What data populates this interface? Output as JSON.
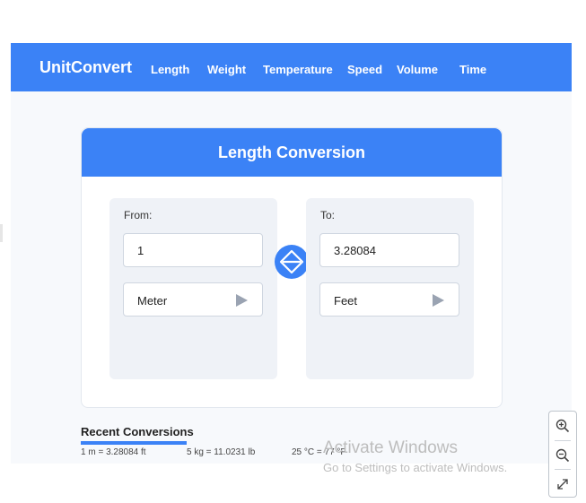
{
  "navbar": {
    "brand": "UnitConvert",
    "links": [
      "Length",
      "Weight",
      "Temperature",
      "Speed",
      "Volume",
      "Time"
    ],
    "bg_color": "#3b82f6"
  },
  "converter": {
    "title": "Length Conversion",
    "from": {
      "label": "From:",
      "value": "1",
      "unit": "Meter"
    },
    "to": {
      "label": "To:",
      "value": "3.28084",
      "unit": "Feet"
    },
    "swap_icon": "swap-icon",
    "dropdown_icon": "triangle-right-icon"
  },
  "recent": {
    "title": "Recent Conversions",
    "items": [
      "1 m = 3.28084 ft",
      "5 kg = 11.0231 lb",
      "25 °C = 77 °F"
    ]
  },
  "watermark": {
    "title": "Activate Windows",
    "subtitle": "Go to Settings to activate Windows."
  },
  "zoom_controls": [
    "zoom-in-icon",
    "zoom-out-icon",
    "fit-screen-icon"
  ]
}
